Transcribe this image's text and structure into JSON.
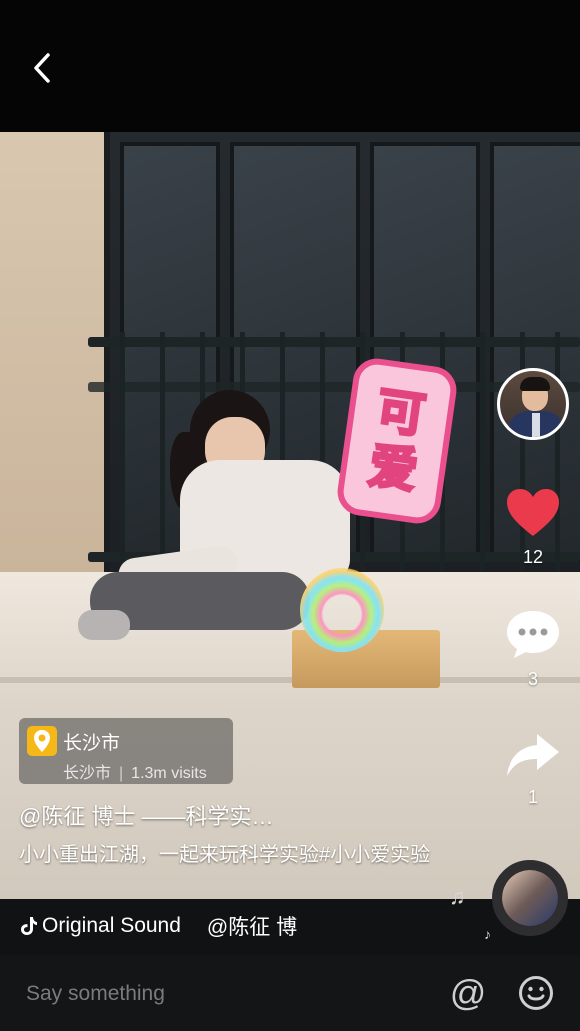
{
  "header": {
    "back_icon": "chevron-left-icon"
  },
  "video": {
    "sticker_text": [
      "可",
      "爱"
    ]
  },
  "sidebar": {
    "likes": {
      "icon": "heart-icon",
      "count": "12",
      "color": "#ea3a4b"
    },
    "comments": {
      "icon": "comment-bubble-icon",
      "count": "3"
    },
    "shares": {
      "icon": "share-arrow-icon",
      "count": "1"
    }
  },
  "location": {
    "title": "长沙市",
    "city": "长沙市",
    "visits": "1.3m visits",
    "icon": "location-pin-icon",
    "icon_color": "#f6b817"
  },
  "post": {
    "author": "@陈征 博士 ——科学实…",
    "caption": "小小重出江湖，一起来玩科学实验#小小爱实验"
  },
  "sound": {
    "label": "Original Sound",
    "author": "@陈征 博",
    "icon": "tiktok-note-icon"
  },
  "comment_bar": {
    "placeholder": "Say something",
    "at_label": "@",
    "emoji_icon": "smiley-icon"
  }
}
